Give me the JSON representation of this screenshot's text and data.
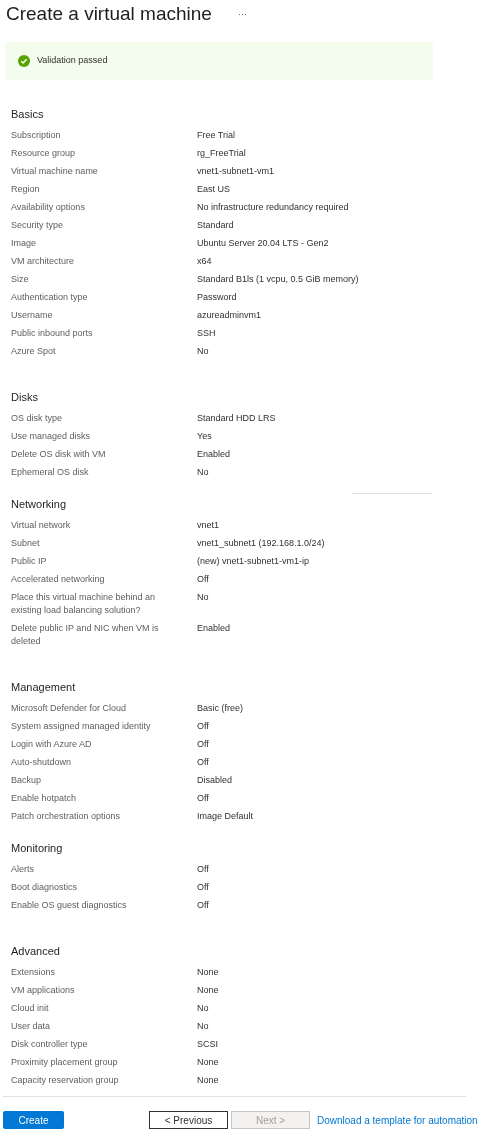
{
  "title": "Create a virtual machine",
  "more": "···",
  "validation": {
    "passed": true,
    "message": "Validation passed"
  },
  "sections": [
    {
      "heading": "Basics",
      "rows": [
        {
          "label": "Subscription",
          "value": "Free Trial"
        },
        {
          "label": "Resource group",
          "value": "rg_FreeTrial"
        },
        {
          "label": "Virtual machine name",
          "value": "vnet1-subnet1-vm1"
        },
        {
          "label": "Region",
          "value": "East US"
        },
        {
          "label": "Availability options",
          "value": "No infrastructure redundancy required"
        },
        {
          "label": "Security type",
          "value": "Standard"
        },
        {
          "label": "Image",
          "value": "Ubuntu Server 20.04 LTS - Gen2"
        },
        {
          "label": "VM architecture",
          "value": "x64"
        },
        {
          "label": "Size",
          "value": "Standard B1ls (1 vcpu, 0.5 GiB memory)"
        },
        {
          "label": "Authentication type",
          "value": "Password"
        },
        {
          "label": "Username",
          "value": "azureadminvm1"
        },
        {
          "label": "Public inbound ports",
          "value": "SSH"
        },
        {
          "label": "Azure Spot",
          "value": "No"
        }
      ]
    },
    {
      "heading": "Disks",
      "rows": [
        {
          "label": "OS disk type",
          "value": "Standard HDD LRS"
        },
        {
          "label": "Use managed disks",
          "value": "Yes"
        },
        {
          "label": "Delete OS disk with VM",
          "value": "Enabled"
        },
        {
          "label": "Ephemeral OS disk",
          "value": "No"
        }
      ]
    },
    {
      "heading": "Networking",
      "rows": [
        {
          "label": "Virtual network",
          "value": "vnet1"
        },
        {
          "label": "Subnet",
          "value": "vnet1_subnet1 (192.168.1.0/24)"
        },
        {
          "label": "Public IP",
          "value": "(new) vnet1-subnet1-vm1-ip"
        },
        {
          "label": "Accelerated networking",
          "value": "Off"
        },
        {
          "label": "Place this virtual machine behind an existing load balancing solution?",
          "value": "No"
        },
        {
          "label": "Delete public IP and NIC when VM is deleted",
          "value": "Enabled"
        }
      ]
    },
    {
      "heading": "Management",
      "rows": [
        {
          "label": "Microsoft Defender for Cloud",
          "value": "Basic (free)"
        },
        {
          "label": "System assigned managed identity",
          "value": "Off"
        },
        {
          "label": "Login with Azure AD",
          "value": "Off"
        },
        {
          "label": "Auto-shutdown",
          "value": "Off"
        },
        {
          "label": "Backup",
          "value": "Disabled"
        },
        {
          "label": "Enable hotpatch",
          "value": "Off"
        },
        {
          "label": "Patch orchestration options",
          "value": "Image Default"
        }
      ]
    },
    {
      "heading": "Monitoring",
      "rows": [
        {
          "label": "Alerts",
          "value": "Off"
        },
        {
          "label": "Boot diagnostics",
          "value": "Off"
        },
        {
          "label": "Enable OS guest diagnostics",
          "value": "Off"
        }
      ]
    },
    {
      "heading": "Advanced",
      "rows": [
        {
          "label": "Extensions",
          "value": "None"
        },
        {
          "label": "VM applications",
          "value": "None"
        },
        {
          "label": "Cloud init",
          "value": "No"
        },
        {
          "label": "User data",
          "value": "No"
        },
        {
          "label": "Disk controller type",
          "value": "SCSI"
        },
        {
          "label": "Proximity placement group",
          "value": "None"
        },
        {
          "label": "Capacity reservation group",
          "value": "None"
        }
      ]
    }
  ],
  "footer": [
    {
      "kind": "primary",
      "label": "Create",
      "disabled": false
    },
    {
      "kind": "secondary",
      "label": "< Previous",
      "disabled": false
    },
    {
      "kind": "secondary",
      "label": "Next >",
      "disabled": true
    },
    {
      "kind": "link",
      "label": "Download a template for automation",
      "disabled": false
    }
  ]
}
